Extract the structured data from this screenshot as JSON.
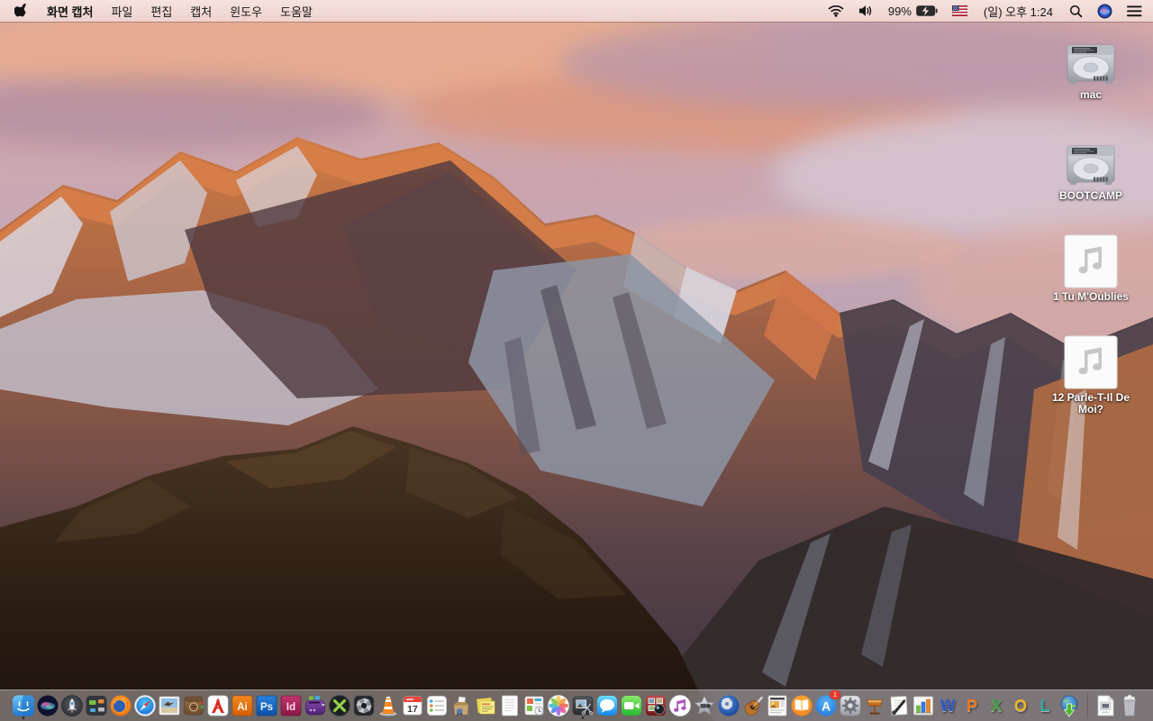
{
  "menubar": {
    "apple_logo": "apple-icon",
    "app_name": "화면 캡처",
    "menus": [
      "파일",
      "편집",
      "캡처",
      "윈도우",
      "도움말"
    ],
    "status": {
      "battery_percent": "99%",
      "clock": "(일) 오후 1:24",
      "icons": [
        "wifi-icon",
        "volume-icon",
        "battery-charging-icon",
        "us-flag-input-source",
        "spotlight-icon",
        "siri-icon",
        "notification-center-icon"
      ]
    }
  },
  "desktop": {
    "icons": [
      {
        "label": "mac",
        "type": "hard-drive"
      },
      {
        "label": "BOOTCAMP",
        "type": "hard-drive"
      },
      {
        "label": "1 Tu M'Oublies",
        "type": "audio-file"
      },
      {
        "label": "12 Parle-T-Il De Moi?",
        "type": "audio-file"
      }
    ]
  },
  "dock": {
    "apps": [
      "finder",
      "siri",
      "launchpad",
      "mission-control",
      "firefox",
      "safari",
      "photo-viewer",
      "leather-folder-app",
      "adobe-acrobat",
      "adobe-illustrator",
      "adobe-photoshop",
      "adobe-indesign",
      "toast-titanium",
      "xbmc-media-center",
      "aperture",
      "vlc",
      "calendar",
      "reminders",
      "archive-utility",
      "stickies",
      "textedit",
      "planner-app",
      "photos",
      "screen-capture",
      "messages",
      "facetime",
      "photo-booth",
      "itunes",
      "imovie",
      "idvd",
      "garageband",
      "iweb",
      "ibooks",
      "app-store",
      "system-preferences",
      "keynote",
      "pages",
      "numbers",
      "ms-word",
      "ms-powerpoint",
      "ms-excel",
      "ms-outlook",
      "ms-lync",
      "download-manager"
    ],
    "adobe_labels": {
      "illustrator": "Ai",
      "photoshop": "Ps",
      "indesign": "Id"
    },
    "office_letters": {
      "word": "W",
      "powerpoint": "P",
      "excel": "X",
      "outlook": "O",
      "lync": "L"
    },
    "calendar_day": "17",
    "app_store_badge": "1",
    "running": [
      "finder",
      "screen-capture"
    ],
    "files": [
      "image-document"
    ],
    "trash_state": "full"
  },
  "colors": {
    "menubar_bg": "#f2dbd6",
    "dock_bg": "rgba(226,222,226,0.42)",
    "sunlit_rock": "#c96e3e",
    "sky_pink": "#d9a8a4",
    "badge_red": "#e8382a"
  }
}
